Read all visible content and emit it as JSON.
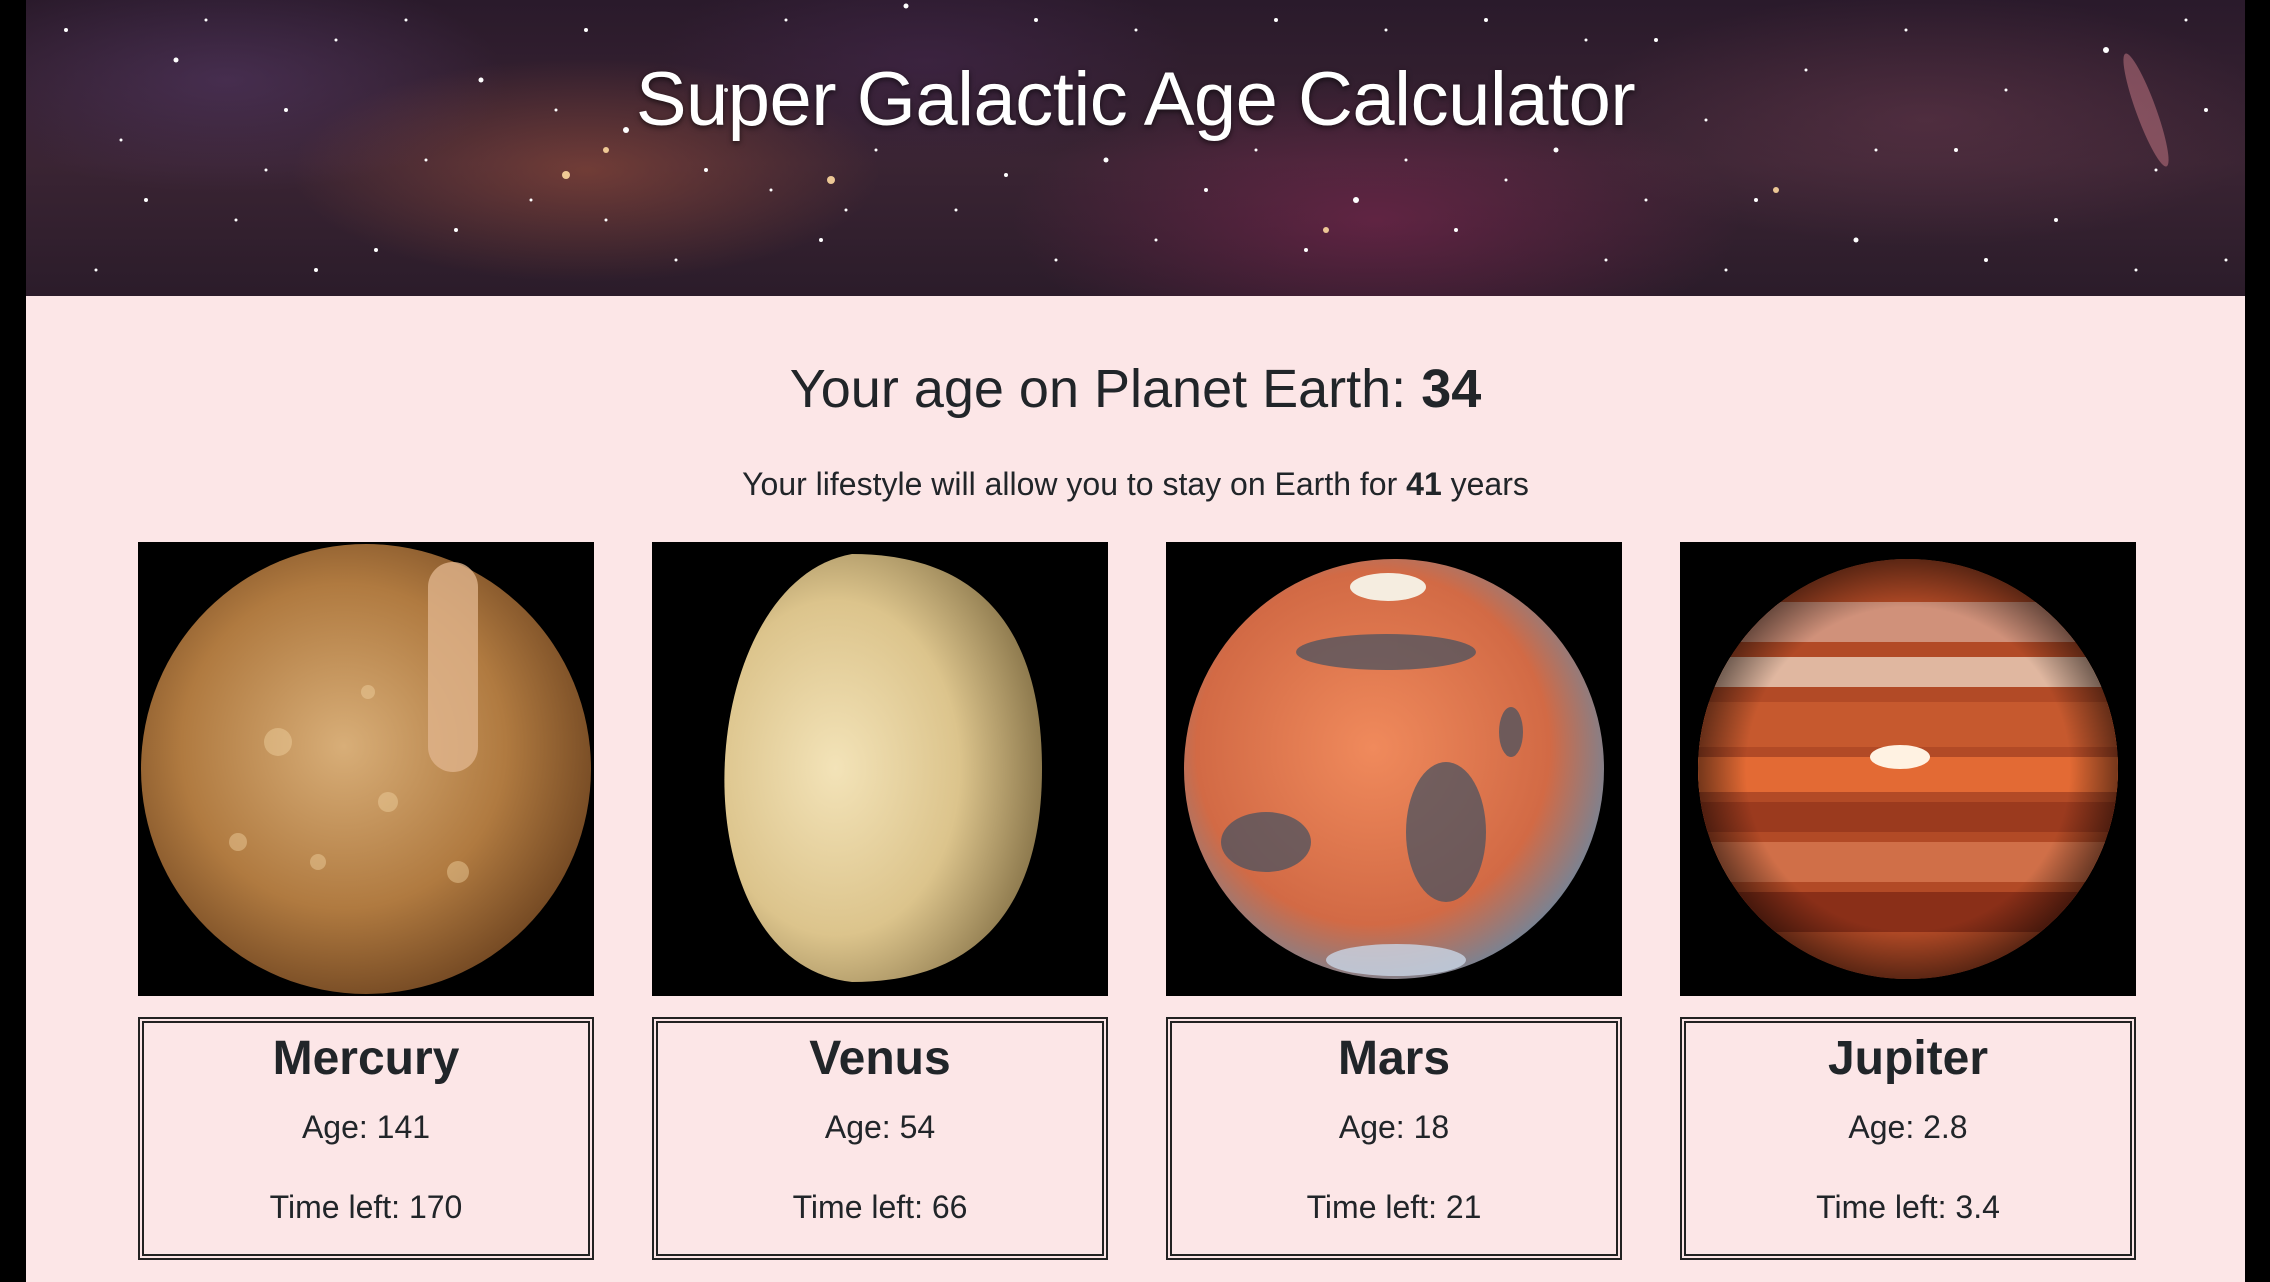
{
  "header": {
    "title": "Super Galactic Age Calculator"
  },
  "summary": {
    "age_prefix": "Your age on Planet Earth: ",
    "earth_age": "34",
    "lifestyle_prefix": "Your lifestyle will allow you to stay on Earth for ",
    "years_left": "41",
    "lifestyle_suffix": " years"
  },
  "planets": [
    {
      "name": "Mercury",
      "age": "Age: 141",
      "time_left": "Time left: 170",
      "icon": "mercury-image"
    },
    {
      "name": "Venus",
      "age": "Age: 54",
      "time_left": "Time left: 66",
      "icon": "venus-image"
    },
    {
      "name": "Mars",
      "age": "Age: 18",
      "time_left": "Time left: 21",
      "icon": "mars-image"
    },
    {
      "name": "Jupiter",
      "age": "Age: 2.8",
      "time_left": "Time left: 3.4",
      "icon": "jupiter-image"
    }
  ],
  "colors": {
    "page_bg": "#fce6e7",
    "text": "#212529",
    "title": "#ffffff"
  }
}
